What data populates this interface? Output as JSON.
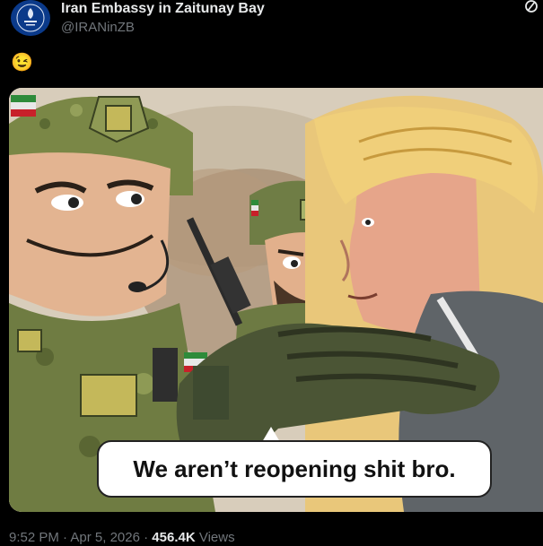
{
  "tweet": {
    "display_name": "Iran Embassy in Zaitunay Bay",
    "handle": "@IRANinZB",
    "text_emoji": "😉",
    "avatar_icon": "embassy-emblem-icon",
    "media": {
      "caption": "We aren’t reopening shit bro."
    },
    "meta": {
      "time": "9:52 PM",
      "separator": "·",
      "date": "Apr 5, 2026",
      "views_count": "456.4K",
      "views_label": "Views"
    }
  },
  "colors": {
    "background": "#000000",
    "primary_text": "#e7e9ea",
    "secondary_text": "#71767b",
    "avatar_bg": "#0b3a8a"
  }
}
